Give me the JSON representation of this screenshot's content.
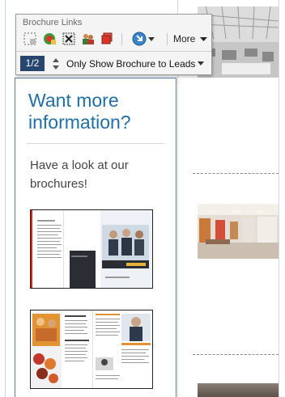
{
  "toolbar": {
    "title": "Brochure Links",
    "more_label": "More",
    "page_indicator": "1/2",
    "filter_label": "Only Show Brochure to Leads",
    "icons": [
      "select-area-icon",
      "bug-edit-icon",
      "delete-link-icon",
      "users-icon",
      "red-box-icon",
      "navigate-arrow-icon"
    ]
  },
  "panel": {
    "title": "Want more information?",
    "text": "Have a look at our brochures!",
    "brochures": [
      "brochure-thumbnail-1",
      "brochure-thumbnail-2"
    ]
  },
  "colors": {
    "title_blue": "#1f6fa6",
    "page_badge_bg": "#27466e",
    "panel_border": "#5a7fa6"
  }
}
